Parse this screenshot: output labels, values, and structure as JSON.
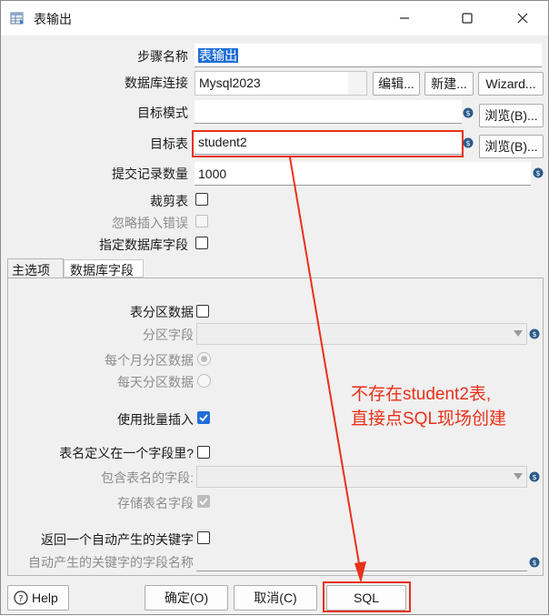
{
  "window": {
    "title": "表输出"
  },
  "form": {
    "step_name_label": "步骤名称",
    "step_name_value": "表输出",
    "db_conn_label": "数据库连接",
    "db_conn_value": "Mysql2023",
    "edit_button": "编辑...",
    "new_button": "新建...",
    "wizard_button": "Wizard...",
    "target_schema_label": "目标模式",
    "target_schema_value": "",
    "browse_schema_button": "浏览(B)...",
    "target_table_label": "目标表",
    "target_table_value": "student2",
    "browse_table_button": "浏览(B)...",
    "commit_size_label": "提交记录数量",
    "commit_size_value": "1000",
    "truncate_label": "裁剪表",
    "ignore_errors_label": "忽略插入错误",
    "specify_fields_label": "指定数据库字段"
  },
  "tabs": {
    "main": "主选项",
    "db_fields": "数据库字段"
  },
  "main_tab": {
    "partition_label": "表分区数据",
    "partition_field_label": "分区字段",
    "monthly_label": "每个月分区数据",
    "daily_label": "每天分区数据",
    "batch_insert_label": "使用批量插入",
    "table_name_in_field_label": "表名定义在一个字段里?",
    "table_name_field_label": "包含表名的字段:",
    "store_table_name_label": "存储表名字段",
    "return_key_label": "返回一个自动产生的关键字",
    "key_field_name_label": "自动产生的关键字的字段名称"
  },
  "annotation": {
    "line1": "不存在student2表,",
    "line2": "直接点SQL现场创建",
    "color": "#e8311a"
  },
  "footer": {
    "help": "Help",
    "ok": "确定(O)",
    "cancel": "取消(C)",
    "sql": "SQL"
  },
  "colors": {
    "selection": "#1f6fd6",
    "highlight": "#e8311a"
  }
}
